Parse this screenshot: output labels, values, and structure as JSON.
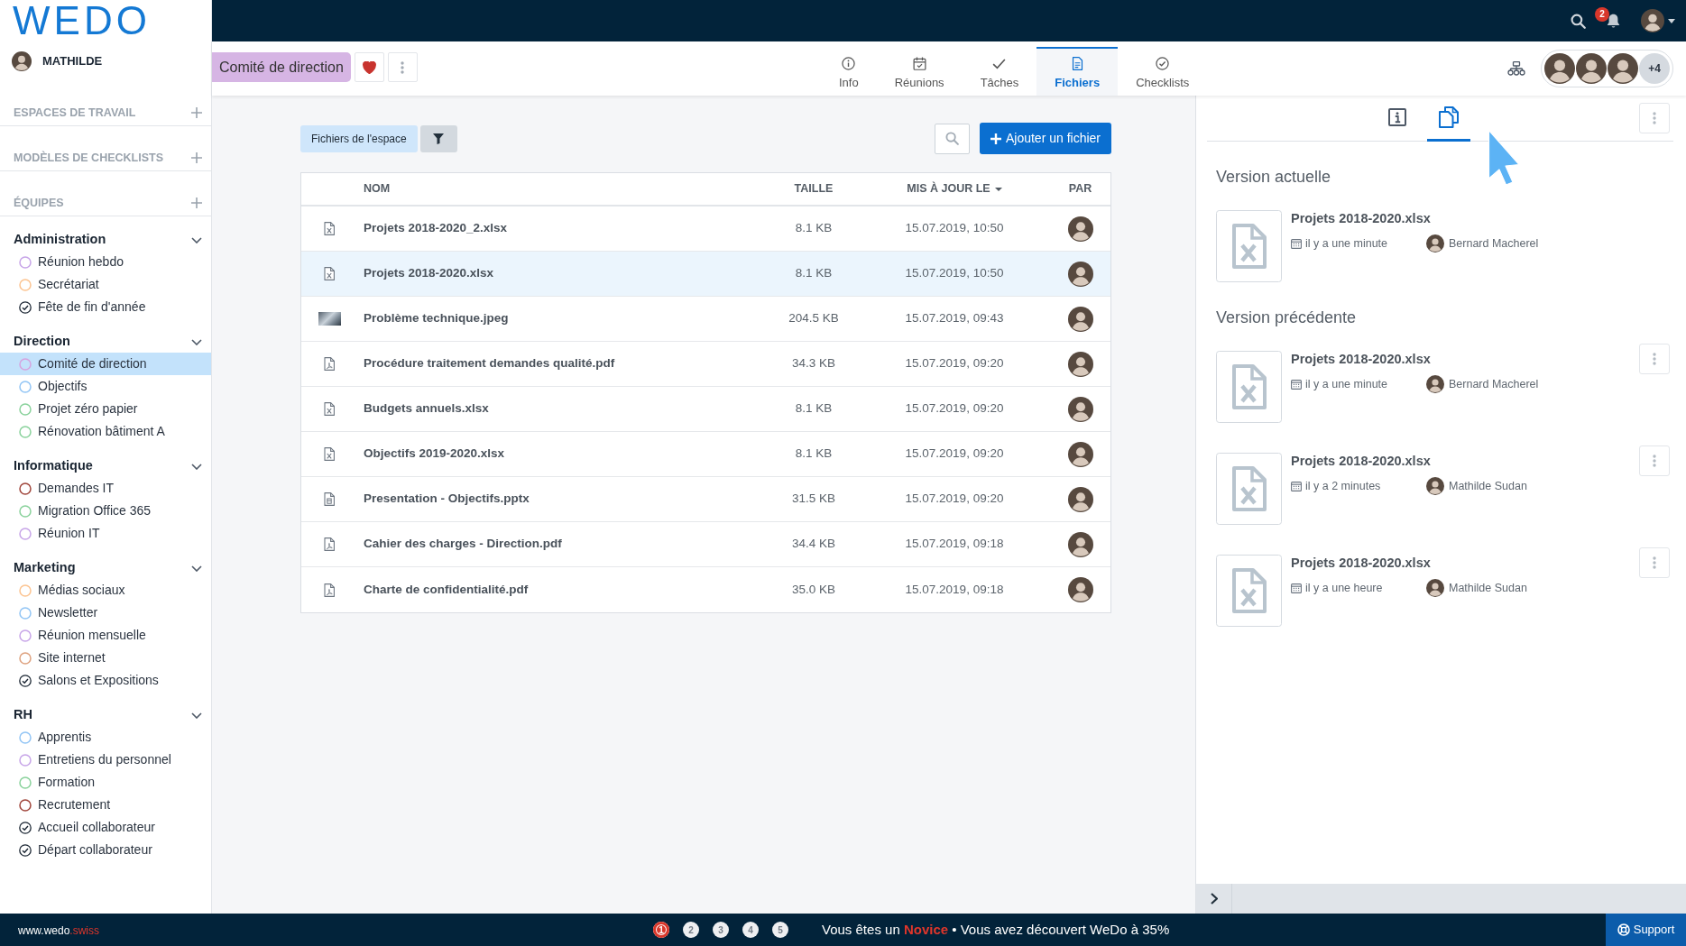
{
  "sidebar": {
    "logo": "WEDO",
    "user": {
      "name": "MATHILDE"
    },
    "sections": [
      {
        "label": "ESPACES DE TRAVAIL"
      },
      {
        "label": "MODÈLES DE CHECKLISTS"
      },
      {
        "label": "ÉQUIPES"
      }
    ],
    "teams": [
      {
        "name": "Administration",
        "expanded": true,
        "items": [
          {
            "label": "Réunion hebdo",
            "kind": "workspace",
            "color": "#c7a5e8",
            "selected": false
          },
          {
            "label": "Secrétariat",
            "kind": "workspace",
            "color": "#fcc491",
            "selected": false
          },
          {
            "label": "Fête de fin d'année",
            "kind": "checklist",
            "selected": false
          }
        ]
      },
      {
        "name": "Direction",
        "expanded": true,
        "items": [
          {
            "label": "Comité de direction",
            "kind": "workspace",
            "color": "#d6a3df",
            "selected": true
          },
          {
            "label": "Objectifs",
            "kind": "workspace",
            "color": "#92c5f5",
            "selected": false
          },
          {
            "label": "Projet zéro papier",
            "kind": "workspace",
            "color": "#8ad29c",
            "selected": false
          },
          {
            "label": "Rénovation bâtiment A",
            "kind": "workspace",
            "color": "#8ad29c",
            "selected": false
          }
        ]
      },
      {
        "name": "Informatique",
        "expanded": true,
        "items": [
          {
            "label": "Demandes IT",
            "kind": "workspace",
            "color": "#a0453b",
            "selected": false
          },
          {
            "label": "Migration Office 365",
            "kind": "workspace",
            "color": "#8ad29c",
            "selected": false
          },
          {
            "label": "Réunion IT",
            "kind": "workspace",
            "color": "#c7a5e8",
            "selected": false
          }
        ]
      },
      {
        "name": "Marketing",
        "expanded": true,
        "items": [
          {
            "label": "Médias sociaux",
            "kind": "workspace",
            "color": "#fcc491",
            "selected": false
          },
          {
            "label": "Newsletter",
            "kind": "workspace",
            "color": "#92c5f5",
            "selected": false
          },
          {
            "label": "Réunion mensuelle",
            "kind": "workspace",
            "color": "#c7a5e8",
            "selected": false
          },
          {
            "label": "Site internet",
            "kind": "workspace",
            "color": "#dea27f",
            "selected": false
          },
          {
            "label": "Salons et Expositions",
            "kind": "checklist",
            "selected": false
          }
        ]
      },
      {
        "name": "RH",
        "expanded": true,
        "items": [
          {
            "label": "Apprentis",
            "kind": "workspace",
            "color": "#92c5f5",
            "selected": false
          },
          {
            "label": "Entretiens du personnel",
            "kind": "workspace",
            "color": "#c7a5e8",
            "selected": false
          },
          {
            "label": "Formation",
            "kind": "workspace",
            "color": "#8ad29c",
            "selected": false
          },
          {
            "label": "Recrutement",
            "kind": "workspace",
            "color": "#a0453b",
            "selected": false
          },
          {
            "label": "Accueil collaborateur",
            "kind": "checklist",
            "selected": false
          },
          {
            "label": "Départ collaborateur",
            "kind": "checklist",
            "selected": false
          }
        ]
      }
    ]
  },
  "topbar": {
    "notifications": "2"
  },
  "header": {
    "workspace": {
      "title": "Comité de direction",
      "favorite": true
    },
    "tabs": [
      {
        "label": "Info",
        "selected": false
      },
      {
        "label": "Réunions",
        "selected": false
      },
      {
        "label": "Tâches",
        "selected": false
      },
      {
        "label": "Fichiers",
        "selected": true
      },
      {
        "label": "Checklists",
        "selected": false
      }
    ],
    "members_more": "+4"
  },
  "files": {
    "scope": "Fichiers de l'espace",
    "add_button": "Ajouter un fichier",
    "columns": [
      {
        "label": "NOM",
        "sorted": false
      },
      {
        "label": "TAILLE",
        "sorted": false
      },
      {
        "label": "MIS À JOUR LE",
        "sorted": true
      },
      {
        "label": "PAR",
        "sorted": false
      }
    ],
    "rows": [
      {
        "kind": "spreadsheet",
        "name": "Projets 2018-2020_2.xlsx",
        "size": "8.1 KB",
        "updated": "15.07.2019, 10:50",
        "selected": false
      },
      {
        "kind": "spreadsheet",
        "name": "Projets 2018-2020.xlsx",
        "size": "8.1 KB",
        "updated": "15.07.2019, 10:50",
        "selected": true
      },
      {
        "kind": "image",
        "name": "Problème technique.jpeg",
        "size": "204.5 KB",
        "updated": "15.07.2019, 09:43",
        "selected": false
      },
      {
        "kind": "pdf",
        "name": "Procédure traitement demandes qualité.pdf",
        "size": "34.3 KB",
        "updated": "15.07.2019, 09:20",
        "selected": false
      },
      {
        "kind": "spreadsheet",
        "name": "Budgets annuels.xlsx",
        "size": "8.1 KB",
        "updated": "15.07.2019, 09:20",
        "selected": false
      },
      {
        "kind": "spreadsheet",
        "name": "Objectifs 2019-2020.xlsx",
        "size": "8.1 KB",
        "updated": "15.07.2019, 09:20",
        "selected": false
      },
      {
        "kind": "presentation",
        "name": "Presentation - Objectifs.pptx",
        "size": "31.5 KB",
        "updated": "15.07.2019, 09:20",
        "selected": false
      },
      {
        "kind": "pdf",
        "name": "Cahier des charges - Direction.pdf",
        "size": "34.4 KB",
        "updated": "15.07.2019, 09:18",
        "selected": false
      },
      {
        "kind": "pdf",
        "name": "Charte de confidentialité.pdf",
        "size": "35.0 KB",
        "updated": "15.07.2019, 09:18",
        "selected": false
      }
    ]
  },
  "details": {
    "tabs": [
      {
        "selected": false
      },
      {
        "selected": true
      }
    ],
    "groups": [
      {
        "heading": "Version actuelle",
        "versions": [
          {
            "name": "Projets 2018-2020.xlsx",
            "time": "il y a une minute",
            "author": "Bernard Macherel",
            "menu": false
          }
        ]
      },
      {
        "heading": "Version précédente",
        "versions": [
          {
            "name": "Projets 2018-2020.xlsx",
            "time": "il y a une minute",
            "author": "Bernard Macherel",
            "menu": true
          },
          {
            "name": "Projets 2018-2020.xlsx",
            "time": "il y a 2 minutes",
            "author": "Mathilde Sudan",
            "menu": true
          },
          {
            "name": "Projets 2018-2020.xlsx",
            "time": "il y a une heure",
            "author": "Mathilde Sudan",
            "menu": true
          }
        ]
      }
    ]
  },
  "status_bar": {
    "site": "www.wedo",
    "site_suffix": ".swiss",
    "steps": [
      {
        "label": "1",
        "selected": true
      },
      {
        "label": "2",
        "selected": false
      },
      {
        "label": "3",
        "selected": false
      },
      {
        "label": "4",
        "selected": false
      },
      {
        "label": "5",
        "selected": false
      }
    ],
    "message": "Vous êtes un **Novice** • Vous avez découvert WeDo à 35%",
    "support": "Support"
  }
}
